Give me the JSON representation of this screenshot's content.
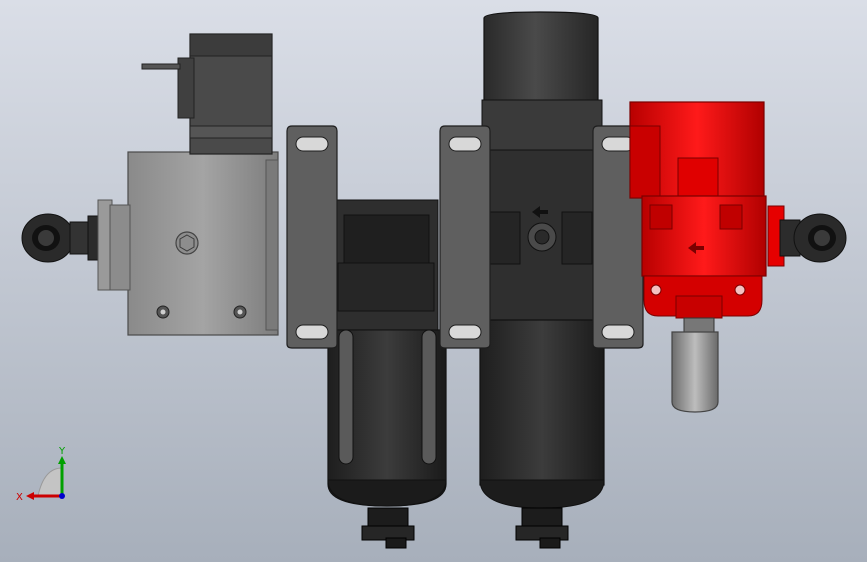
{
  "viewport": {
    "background_top": "#d9dde6",
    "background_bottom": "#a9b1bd"
  },
  "colors": {
    "dark_body": "#3a3a3a",
    "mid_grey": "#7a7a7a",
    "light_grey": "#9c9c9c",
    "red_body": "#d00000",
    "red_light": "#ff2a2a"
  },
  "triad": {
    "x_label": "X",
    "y_label": "Y",
    "x_color": "#cc0000",
    "y_color": "#00aa00",
    "z_color": "#0000cc"
  }
}
